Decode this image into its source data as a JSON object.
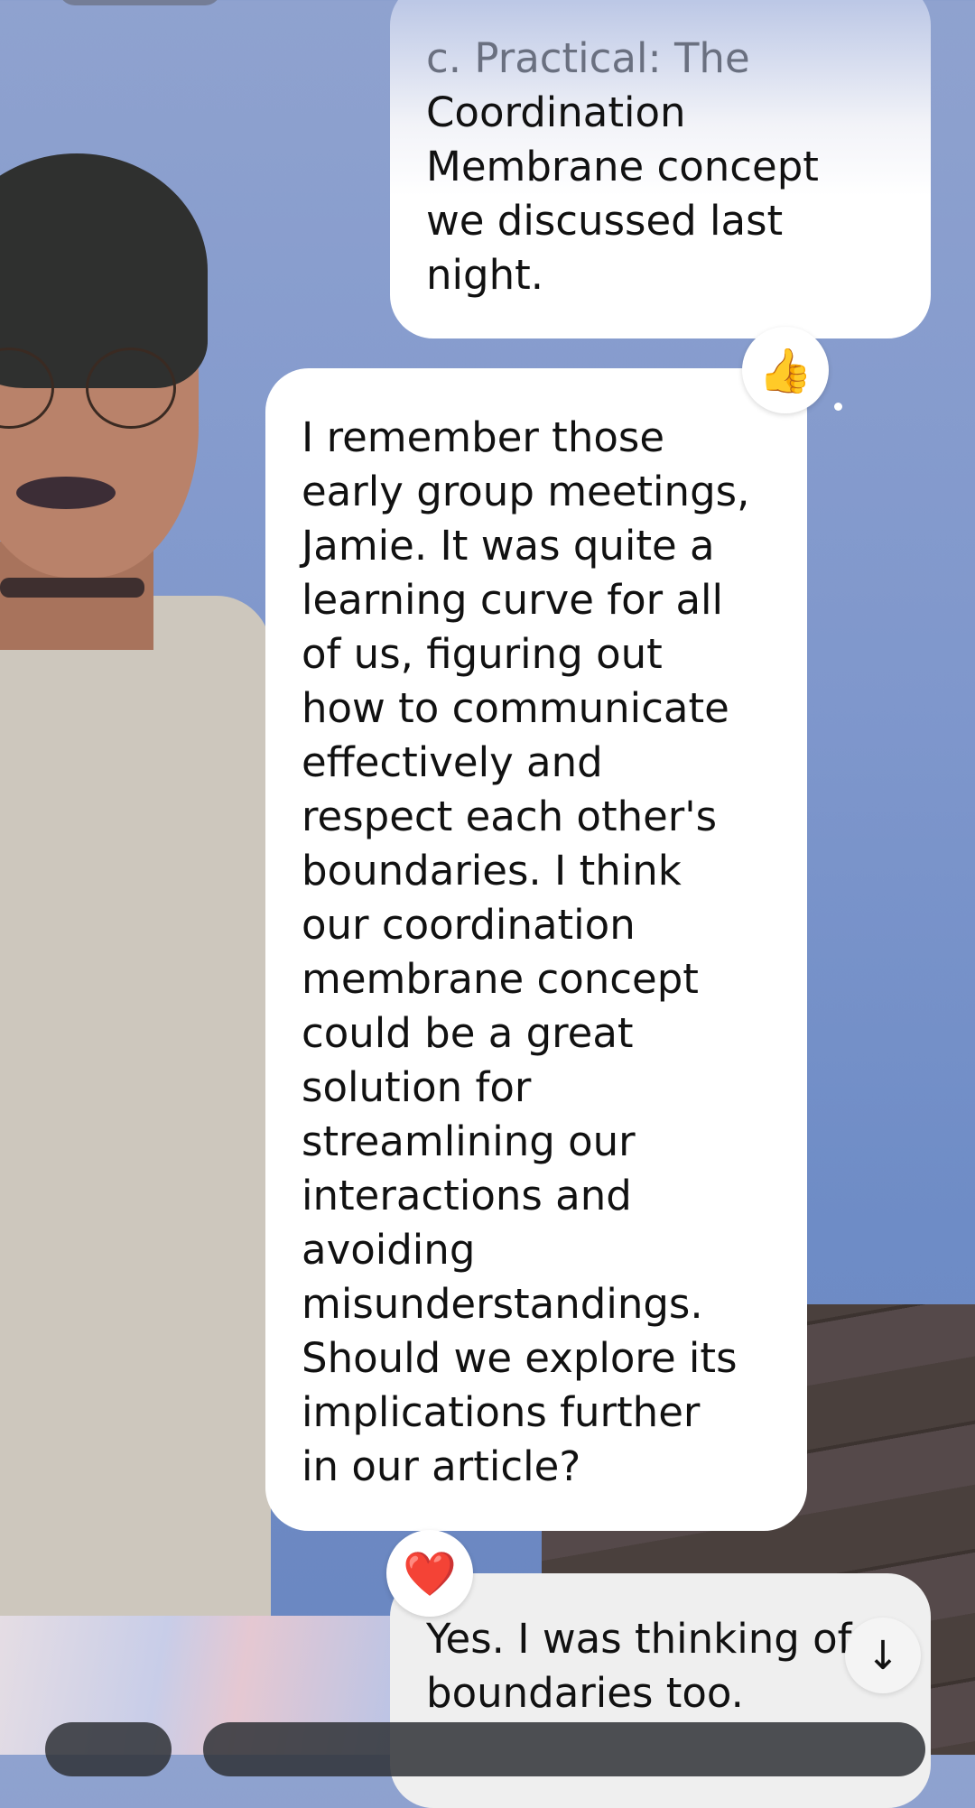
{
  "messages": [
    {
      "role": "user",
      "lines": [
        "c. Practical: The",
        "Coordination",
        "Membrane concept",
        "we discussed last",
        "night."
      ],
      "reaction": "👍"
    },
    {
      "role": "character",
      "lines": [
        "I remember those",
        "early group meetings,",
        "Jamie. It was quite a",
        "learning curve for all",
        "of us, figuring out",
        "how to communicate",
        "effectively and",
        "respect each other's",
        "boundaries. I think",
        "our coordination",
        "membrane concept",
        "could be a great",
        "solution for",
        "streamlining our",
        "interactions and",
        "avoiding",
        "misunderstandings.",
        "Should we explore its",
        "implications further",
        "in our article?"
      ],
      "reaction": "❤️"
    },
    {
      "role": "user",
      "lines": [
        "Yes. I was thinking of",
        "boundaries too."
      ]
    }
  ],
  "scroll_down_icon": "↓"
}
